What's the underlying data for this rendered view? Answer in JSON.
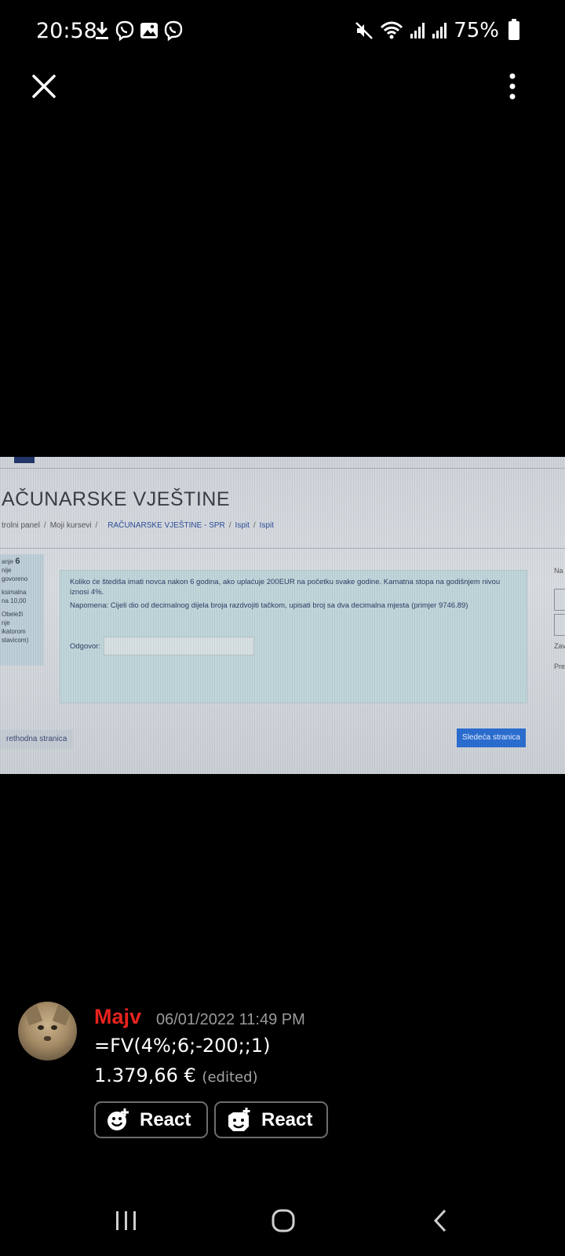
{
  "status_bar": {
    "time": "20:58",
    "battery_percent": "75%",
    "icons_left": [
      "download-icon",
      "viber-icon",
      "gallery-icon",
      "viber-icon"
    ],
    "icons_right": [
      "mute-icon",
      "wifi-icon",
      "signal-icon",
      "signal-icon",
      "battery-icon"
    ]
  },
  "toolbar": {
    "close_icon": "close-icon",
    "more_icon": "more-vertical-icon"
  },
  "photo": {
    "title": "AČUNARSKE VJEŠTINE",
    "breadcrumb": [
      "trolni panel",
      "Moji kursevi",
      "RAČUNARSKE VJEŠTINE - SPR",
      "Ispit",
      "Ispit"
    ],
    "left_panel": {
      "label": "anje",
      "number": "6",
      "lines": [
        "nije",
        "govoreno",
        "",
        "ksimalna",
        "na 10,00",
        "",
        "Obeleži",
        "nje",
        "ikatorom",
        "stavicom)"
      ]
    },
    "question_text": "Koliko će štediša imati novca nakon 6 godina, ako uplaćuje 200EUR na početku svake godine. Kamatna stopa na godišnjem nivou iznosi 4%.",
    "note_text": "Napomena: Cijeli dio od decimalnog dijela broja razdvojiti tačkom, upisati broj sa dva decimalna mjesta (primjer 9746.89)",
    "answer_label": "Odgovor:",
    "prev_button": "rethodna stranica",
    "next_button": "Sledeća stranica",
    "right_col": [
      "Na",
      "Zav",
      "Pre"
    ]
  },
  "comment": {
    "username": "Majv",
    "timestamp": "06/01/2022 11:49 PM",
    "line1": "=FV(4%;6;-200;;1)",
    "line2": "1.379,66 €",
    "edited": "(edited)",
    "react_buttons": [
      {
        "label": "React",
        "icon": "add-reaction-icon"
      },
      {
        "label": "React",
        "icon": "add-sticker-reaction-icon"
      }
    ]
  },
  "nav_bar": {
    "buttons": [
      "recents-icon",
      "home-icon",
      "back-icon"
    ]
  },
  "colors": {
    "background": "#000000",
    "username": "#e8231d",
    "next_button": "#2b6ed1"
  }
}
